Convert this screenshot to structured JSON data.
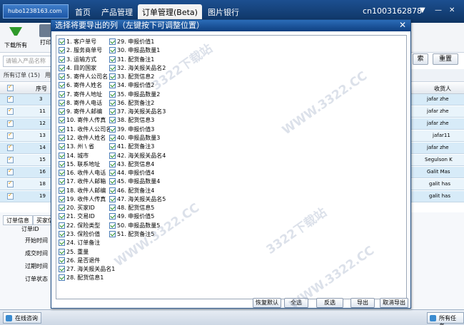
{
  "app": {
    "logo_text": "hubo1238163.com",
    "nav": [
      "首页",
      "产品管理",
      "订单管理(Beta)",
      "图片银行"
    ],
    "account": "cn1003162878",
    "window_controls": [
      "▼",
      "—",
      "✕"
    ]
  },
  "toolbar": {
    "download_all": "下载所有",
    "print": "打印"
  },
  "search": {
    "placeholder": "请输入产品名称",
    "search_btn": "索",
    "reset_btn": "重置"
  },
  "tabs": {
    "all_orders": "所有订单 (15)",
    "other": "用"
  },
  "table": {
    "col_seq": "序号",
    "col_receiver": "收货人",
    "rows": [
      {
        "seq": "3",
        "name": "jafar zhe"
      },
      {
        "seq": "11",
        "name": "jafar zhe"
      },
      {
        "seq": "12",
        "name": "jafar zhe"
      },
      {
        "seq": "13",
        "name": "jafar11"
      },
      {
        "seq": "14",
        "name": "jafar zhe"
      },
      {
        "seq": "15",
        "name": "Segulson K"
      },
      {
        "seq": "16",
        "name": "Galit Mas"
      },
      {
        "seq": "18",
        "name": "galit has"
      },
      {
        "seq": "19",
        "name": "galit has"
      }
    ]
  },
  "info": {
    "tab_order_info": "订单信息",
    "tab_buyer": "买家信",
    "labels": [
      "订单ID",
      "开始时间",
      "成交时间",
      "过期时间",
      "订单状态"
    ]
  },
  "statusbar": {
    "online": "在线咨询",
    "tasks": "所有任务"
  },
  "dialog": {
    "title": "选择将要导出的列（左键按下可调整位置）",
    "close": "✕",
    "col1": [
      "1. 客户单号",
      "2. 服务商单号",
      "3. 运输方式",
      "4. 目的国家",
      "5. 寄件人公司名",
      "6. 寄件人姓名",
      "7. 寄件人地址",
      "8. 寄件人电话",
      "9. 寄件人邮编",
      "10. 寄件人传真",
      "11. 收件人公司名",
      "12. 收件人姓名",
      "13. 州 \\ 省",
      "14. 城市",
      "15. 联系地址",
      "16. 收件人电话",
      "17. 收件人邮箱",
      "18. 收件人邮编",
      "19. 收件人传真",
      "20. 买家ID",
      "21. 交易ID",
      "22. 保险类型",
      "23. 保险价值",
      "24. 订单备注",
      "25. 重量",
      "26. 是否退件",
      "27. 海关报关品名1",
      "28. 配货信息1"
    ],
    "col2": [
      "29. 申报价值1",
      "30. 申报品数量1",
      "31. 配货备注1",
      "32. 海关报关品名2",
      "33. 配货信息2",
      "34. 申报价值2",
      "35. 申报品数量2",
      "36. 配货备注2",
      "37. 海关报关品名3",
      "38. 配货信息3",
      "39. 申报价值3",
      "40. 申报品数量3",
      "41. 配货备注3",
      "42. 海关报关品名4",
      "43. 配货信息4",
      "44. 申报价值4",
      "45. 申报品数量4",
      "46. 配货备注4",
      "47. 海关报关品名5",
      "48. 配货信息5",
      "49. 申报价值5",
      "50. 申报品数量5",
      "51. 配货备注5"
    ],
    "buttons": [
      "恢复默认",
      "全选",
      "反选",
      "导出",
      "取消导出"
    ]
  },
  "watermarks": [
    "3322下载站",
    "WWW.3322.CC"
  ]
}
